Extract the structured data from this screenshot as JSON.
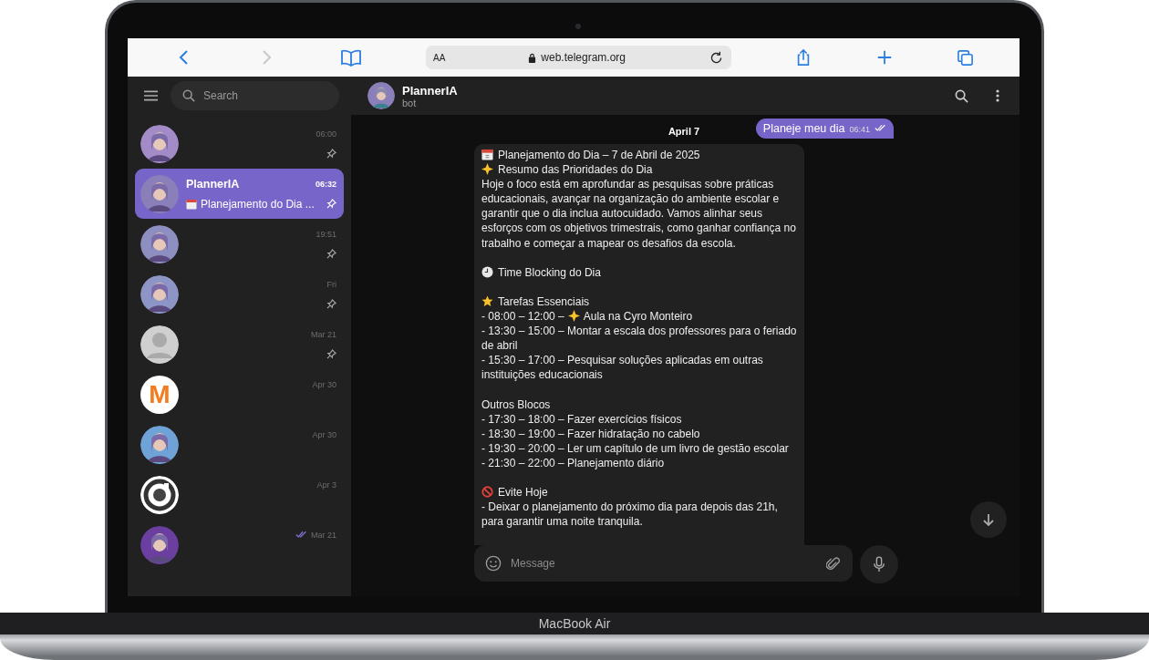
{
  "device": {
    "label": "MacBook Air"
  },
  "browser": {
    "text_size": "AA",
    "url": "web.telegram.org"
  },
  "sidebar": {
    "search": {
      "placeholder": "Search"
    },
    "chats": [
      {
        "kind": "picture",
        "time": "06:00",
        "pinned": true,
        "read": false,
        "selected": false
      },
      {
        "kind": "picture",
        "name": "PlannerIA",
        "preview": "Planejamento do Dia ...",
        "time": "06:32",
        "pinned": true,
        "read": false,
        "selected": true
      },
      {
        "kind": "picture",
        "time": "19:51",
        "pinned": true,
        "read": false,
        "selected": false
      },
      {
        "kind": "picture",
        "time": "Fri",
        "pinned": true,
        "read": false,
        "selected": false
      },
      {
        "kind": "placeholder",
        "time": "Mar 21",
        "pinned": true,
        "read": false,
        "selected": false
      },
      {
        "kind": "letter",
        "letter": "M",
        "color": "#f47b20",
        "time": "Apr 30",
        "pinned": false,
        "read": false,
        "selected": false
      },
      {
        "kind": "picture",
        "time": "Apr 30",
        "pinned": false,
        "read": false,
        "selected": false
      },
      {
        "kind": "ring",
        "time": "Apr 3",
        "pinned": false,
        "read": false,
        "selected": false
      },
      {
        "kind": "picture",
        "time": "Mar 21",
        "pinned": false,
        "read": true,
        "selected": false
      }
    ]
  },
  "chat": {
    "title": "PlannerIA",
    "subtitle": "bot",
    "date": "April 7",
    "outgoing": {
      "text": "Planeje meu dia",
      "time": "06:41",
      "read": true
    },
    "incoming": [
      {
        "lines": [
          {
            "kind": "calendar",
            "text": "Planejamento do Dia – 7 de Abril de 2025"
          },
          {
            "kind": "glow-star",
            "text": "Resumo das Prioridades do Dia"
          },
          {
            "kind": "plain",
            "text": "Hoje o foco está em aprofundar as pesquisas sobre práticas educacionais, avançar na organização do ambiente escolar e garantir que o dia inclua autocuidado. Vamos alinhar seus esforços com os objetivos trimestrais, como ganhar confiança no trabalho e começar a mapear os desafios da escola."
          }
        ]
      },
      {
        "lines": [
          {
            "kind": "clock",
            "text": "Time Blocking do Dia"
          }
        ]
      },
      {
        "lines": [
          {
            "kind": "star",
            "text": "Tarefas Essenciais"
          },
          {
            "kind": "inline-glow-star",
            "text": "- 08:00 – 12:00 –",
            "text_after": "Aula na Cyro Monteiro"
          },
          {
            "kind": "plain",
            "text": "- 13:30 – 15:00 – Montar a escala dos professores para o feriado de abril"
          },
          {
            "kind": "plain",
            "text": "- 15:30 – 17:00 – Pesquisar soluções aplicadas em outras instituições educacionais"
          }
        ]
      },
      {
        "lines": [
          {
            "kind": "plain",
            "text": "Outros Blocos"
          },
          {
            "kind": "plain",
            "text": "- 17:30 – 18:00 – Fazer exercícios físicos"
          },
          {
            "kind": "plain",
            "text": "- 18:30 – 19:00 – Fazer hidratação no cabelo"
          },
          {
            "kind": "plain",
            "text": "- 19:30 – 20:00 – Ler um capítulo de um livro de gestão escolar"
          },
          {
            "kind": "plain",
            "text": "- 21:30 – 22:00 – Planejamento diário"
          }
        ]
      },
      {
        "lines": [
          {
            "kind": "no-entry",
            "text": "Evite Hoje"
          },
          {
            "kind": "plain",
            "text": "- Deixar o planejamento do próximo dia para depois das 21h, para garantir uma noite tranquila."
          }
        ]
      }
    ],
    "composer": {
      "placeholder": "Message"
    }
  }
}
